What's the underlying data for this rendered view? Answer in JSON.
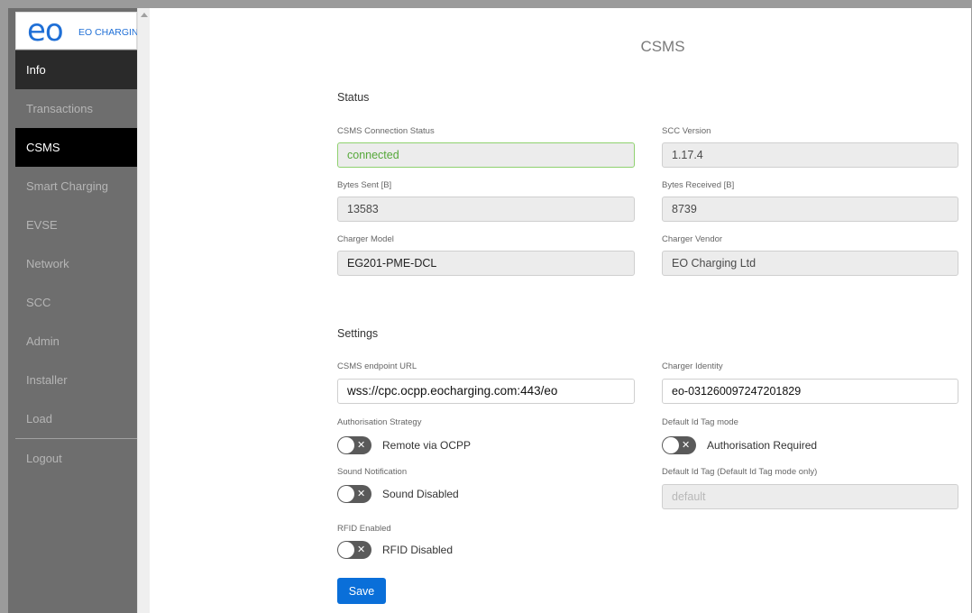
{
  "logo": {
    "mark": "eo",
    "text": "EO CHARGING"
  },
  "nav": [
    {
      "label": "Info"
    },
    {
      "label": "Transactions"
    },
    {
      "label": "CSMS"
    },
    {
      "label": "Smart Charging"
    },
    {
      "label": "EVSE"
    },
    {
      "label": "Network"
    },
    {
      "label": "SCC"
    },
    {
      "label": "Admin"
    },
    {
      "label": "Installer"
    },
    {
      "label": "Load"
    },
    {
      "label": "Logout"
    }
  ],
  "page": {
    "title": "CSMS"
  },
  "status": {
    "title": "Status",
    "connection_label": "CSMS Connection Status",
    "connection_value": "connected",
    "scc_version_label": "SCC Version",
    "scc_version_value": "1.17.4",
    "bytes_sent_label": "Bytes Sent [B]",
    "bytes_sent_value": "13583",
    "bytes_received_label": "Bytes Received [B]",
    "bytes_received_value": "8739",
    "charger_model_label": "Charger Model",
    "charger_model_value": "EG201-PME-DCL",
    "charger_vendor_label": "Charger Vendor",
    "charger_vendor_value": "EO Charging Ltd"
  },
  "settings": {
    "title": "Settings",
    "endpoint_label": "CSMS endpoint URL",
    "endpoint_value": "wss://cpc.ocpp.eocharging.com:443/eo",
    "identity_label": "Charger Identity",
    "identity_value": "eo-031260097247201829",
    "auth_label": "Authorisation Strategy",
    "auth_toggle": "Remote via OCPP",
    "idtag_mode_label": "Default Id Tag mode",
    "idtag_mode_toggle": "Authorisation Required",
    "sound_label": "Sound Notification",
    "sound_toggle": "Sound Disabled",
    "idtag_label": "Default Id Tag (Default Id Tag mode only)",
    "idtag_placeholder": "default",
    "rfid_label": "RFID Enabled",
    "rfid_toggle": "RFID Disabled",
    "save_label": "Save"
  },
  "colors": {
    "accent": "#0a6fd9",
    "connected": "#56a83a",
    "logo": "#1f6fd6",
    "sidebar": "#6e6e6e"
  }
}
